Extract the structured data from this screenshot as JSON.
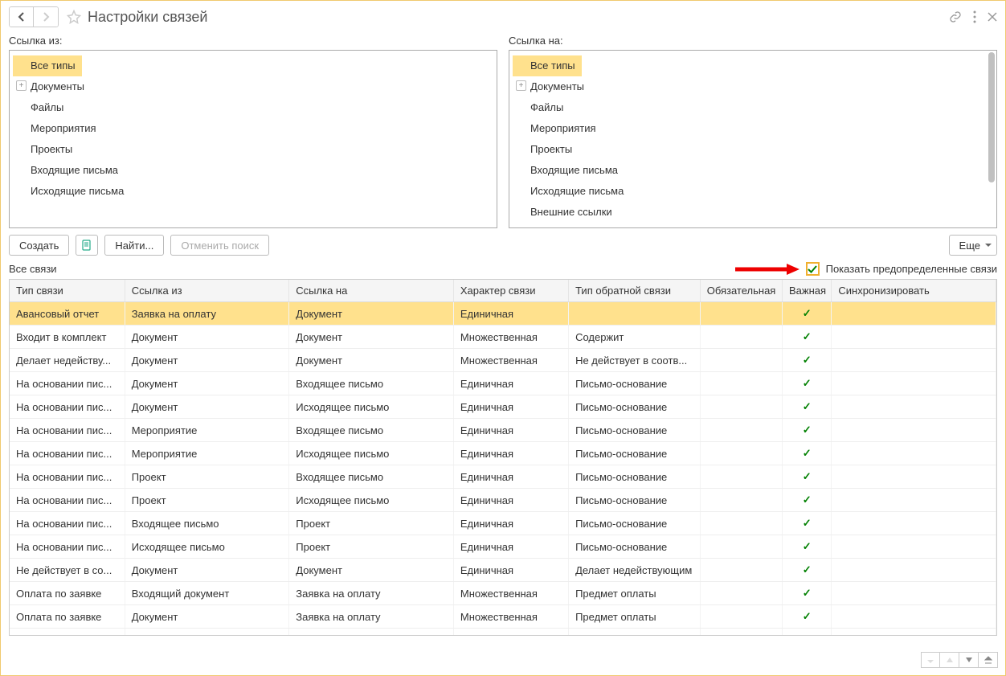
{
  "header": {
    "title": "Настройки связей"
  },
  "panels": {
    "left": {
      "label": "Ссылка из:",
      "items": [
        "Все типы",
        "Документы",
        "Файлы",
        "Мероприятия",
        "Проекты",
        "Входящие письма",
        "Исходящие письма"
      ],
      "selected": 0,
      "expandable": [
        1
      ]
    },
    "right": {
      "label": "Ссылка на:",
      "items": [
        "Все типы",
        "Документы",
        "Файлы",
        "Мероприятия",
        "Проекты",
        "Входящие письма",
        "Исходящие письма",
        "Внешние ссылки"
      ],
      "selected": 0,
      "expandable": [
        1
      ]
    }
  },
  "toolbar": {
    "create": "Создать",
    "find": "Найти...",
    "cancel_search": "Отменить поиск",
    "more": "Еще"
  },
  "subheader": {
    "title": "Все связи",
    "checkbox_label": "Показать предопределенные связи",
    "checked": true
  },
  "table": {
    "columns": [
      "Тип связи",
      "Ссылка из",
      "Ссылка на",
      "Характер связи",
      "Тип обратной связи",
      "Обязательная",
      "Важная",
      "Синхронизировать"
    ],
    "selected": 0,
    "rows": [
      {
        "c": [
          "Авансовый отчет",
          "Заявка на оплату",
          "Документ",
          "Единичная",
          "",
          "",
          "✓",
          ""
        ]
      },
      {
        "c": [
          "Входит в комплект",
          "Документ",
          "Документ",
          "Множественная",
          "Содержит",
          "",
          "✓",
          ""
        ]
      },
      {
        "c": [
          "Делает недейству...",
          "Документ",
          "Документ",
          "Множественная",
          "Не действует в соотв...",
          "",
          "✓",
          ""
        ]
      },
      {
        "c": [
          "На основании пис...",
          "Документ",
          "Входящее письмо",
          "Единичная",
          "Письмо-основание",
          "",
          "✓",
          ""
        ]
      },
      {
        "c": [
          "На основании пис...",
          "Документ",
          "Исходящее письмо",
          "Единичная",
          "Письмо-основание",
          "",
          "✓",
          ""
        ]
      },
      {
        "c": [
          "На основании пис...",
          "Мероприятие",
          "Входящее письмо",
          "Единичная",
          "Письмо-основание",
          "",
          "✓",
          ""
        ]
      },
      {
        "c": [
          "На основании пис...",
          "Мероприятие",
          "Исходящее письмо",
          "Единичная",
          "Письмо-основание",
          "",
          "✓",
          ""
        ]
      },
      {
        "c": [
          "На основании пис...",
          "Проект",
          "Входящее письмо",
          "Единичная",
          "Письмо-основание",
          "",
          "✓",
          ""
        ]
      },
      {
        "c": [
          "На основании пис...",
          "Проект",
          "Исходящее письмо",
          "Единичная",
          "Письмо-основание",
          "",
          "✓",
          ""
        ]
      },
      {
        "c": [
          "На основании пис...",
          "Входящее письмо",
          "Проект",
          "Единичная",
          "Письмо-основание",
          "",
          "✓",
          ""
        ]
      },
      {
        "c": [
          "На основании пис...",
          "Исходящее письмо",
          "Проект",
          "Единичная",
          "Письмо-основание",
          "",
          "✓",
          ""
        ]
      },
      {
        "c": [
          "Не действует в со...",
          "Документ",
          "Документ",
          "Единичная",
          "Делает недействующим",
          "",
          "✓",
          ""
        ]
      },
      {
        "c": [
          "Оплата по заявке",
          "Входящий документ",
          "Заявка на оплату",
          "Множественная",
          "Предмет оплаты",
          "",
          "✓",
          ""
        ]
      },
      {
        "c": [
          "Оплата по заявке",
          "Документ",
          "Заявка на оплату",
          "Множественная",
          "Предмет оплаты",
          "",
          "✓",
          ""
        ]
      },
      {
        "c": [
          "",
          "",
          "",
          "",
          "",
          "",
          "✓",
          ""
        ]
      }
    ]
  }
}
